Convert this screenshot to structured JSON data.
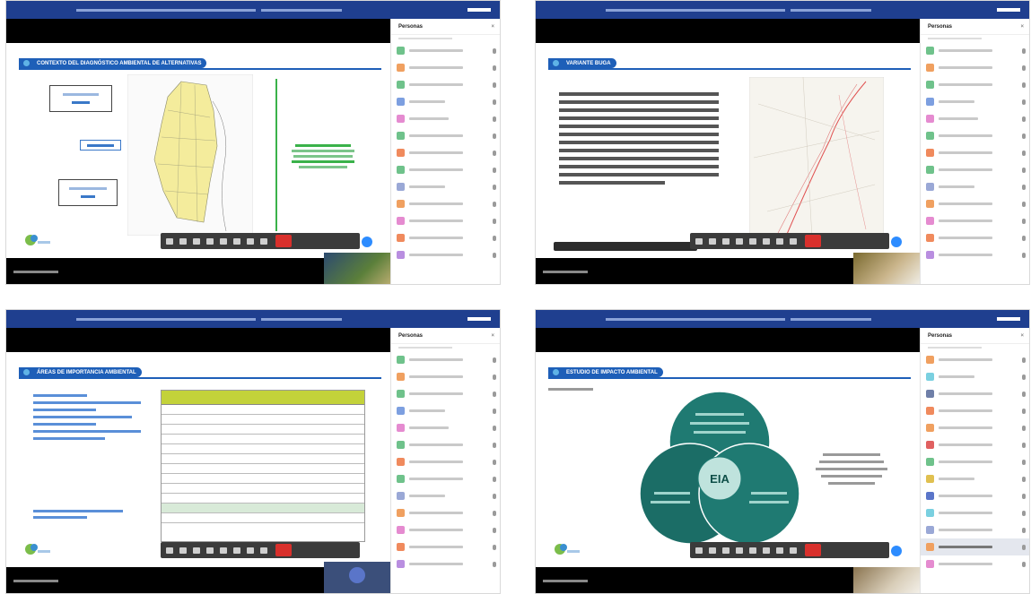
{
  "panels": [
    {
      "slide_title": "CONTEXTO DEL DIAGNÓSTICO AMBIENTAL DE ALTERNATIVAS"
    },
    {
      "slide_title": "VARIANTE BUGA"
    },
    {
      "slide_title": "ÁREAS DE IMPORTANCIA AMBIENTAL"
    },
    {
      "slide_title": "ESTUDIO DE IMPACTO AMBIENTAL"
    }
  ],
  "sidebar": {
    "title": "Personas"
  },
  "diagram": {
    "center": "EIA"
  },
  "colors": {
    "accent": "#1e5fb8",
    "banner": "#1f3f8f",
    "end_button": "#d9302c",
    "teal": "#1f7a72"
  }
}
